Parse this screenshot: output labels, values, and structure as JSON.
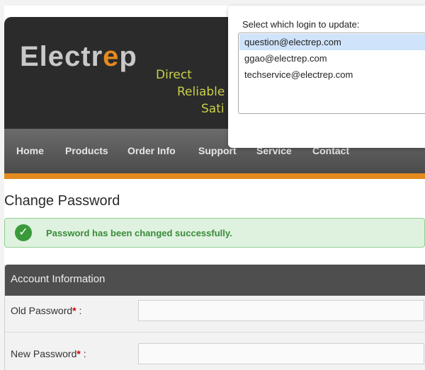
{
  "site": {
    "logo_text_1": "Electr",
    "logo_text_accent": "e",
    "logo_text_2": "p",
    "tagline": [
      "Direct",
      "Reliable",
      "Sati"
    ],
    "nav": [
      "Home",
      "Products",
      "Order Info",
      "Support",
      "Service",
      "Contact"
    ],
    "page_title": "Change Password",
    "success_message": "Password has been changed successfully.",
    "account_section_title": "Account Information",
    "fields": [
      {
        "label": "Old Password",
        "required_mark": "*",
        "suffix": ":"
      },
      {
        "label": "New Password",
        "required_mark": "*",
        "suffix": ":"
      }
    ]
  },
  "login_picker": {
    "prompt": "Select which login to update:",
    "options": [
      "question@electrep.com",
      "ggao@electrep.com",
      "techservice@electrep.com"
    ],
    "selected_index": 0
  },
  "colors": {
    "header_bg": "#2b2b2b",
    "accent_orange": "#e58a1f",
    "success_green": "#3a9a3a",
    "selected_row": "#cfe3fb"
  }
}
